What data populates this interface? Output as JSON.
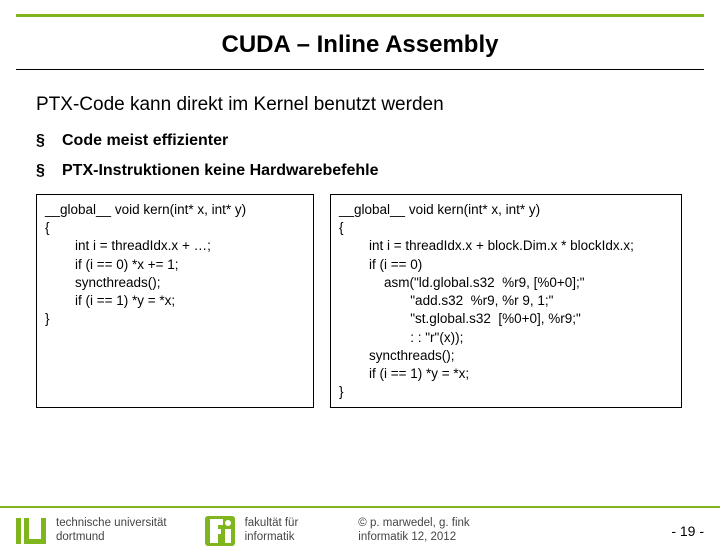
{
  "title": "CUDA – Inline Assembly",
  "lead": "PTX-Code kann direkt im Kernel benutzt werden",
  "bullets": {
    "b1": "Code meist effizienter",
    "b2": "PTX-Instruktionen keine Hardwarebefehle"
  },
  "code": {
    "left": "__global__ void kern(int* x, int* y)\n{\n        int i = threadIdx.x + …;\n        if (i == 0) *x += 1;\n        syncthreads();\n        if (i == 1) *y = *x;\n}",
    "right": "__global__ void kern(int* x, int* y)\n{\n        int i = threadIdx.x + block.Dim.x * blockIdx.x;\n        if (i == 0)\n            asm(\"ld.global.s32  %r9, [%0+0];\"\n                   \"add.s32  %r9, %r 9, 1;\"\n                   \"st.global.s32  [%0+0], %r9;\"\n                   : : \"r\"(x));\n        syncthreads();\n        if (i == 1) *y = *x;\n}"
  },
  "footer": {
    "uni1": "technische universität",
    "uni2": "dortmund",
    "fak1": "fakultät für",
    "fak2": "informatik",
    "cred1": "©  p. marwedel, g. fink",
    "cred2": "informatik 12,  2012",
    "page": "-  19 -"
  }
}
